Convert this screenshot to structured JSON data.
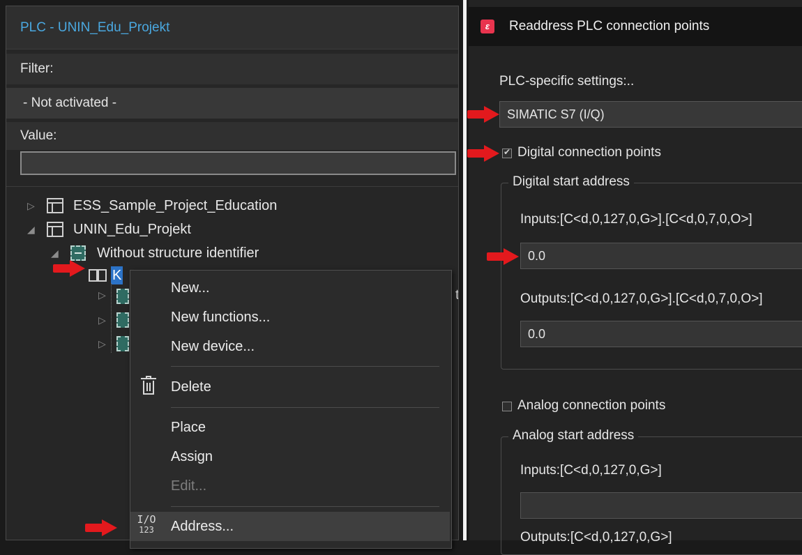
{
  "left_panel": {
    "title": "PLC - UNIN_Edu_Projekt",
    "filter_label": "Filter:",
    "filter_value": "- Not activated -",
    "value_label": "Value:",
    "value_input": "",
    "tree": {
      "items": [
        {
          "label": "ESS_Sample_Project_Education",
          "icon": "project-icon"
        },
        {
          "label": "UNIN_Edu_Projekt",
          "icon": "project-icon"
        },
        {
          "label": "Without structure identifier",
          "icon": "structure-identifier-icon"
        },
        {
          "label": "K",
          "icon": "book-icon",
          "selected": true
        }
      ],
      "stray_char": "t"
    }
  },
  "context_menu": {
    "items": {
      "new": "New...",
      "new_functions": "New functions...",
      "new_device": "New device...",
      "delete": "Delete",
      "place": "Place",
      "assign": "Assign",
      "edit": "Edit...",
      "address": "Address..."
    },
    "io_icon": {
      "top": "I/O",
      "bottom": "123"
    }
  },
  "dialog": {
    "title": "Readdress PLC connection points",
    "plc_settings_label": "PLC-specific settings:..",
    "plc_settings_value": "SIMATIC S7 (I/Q)",
    "digital_checkbox_label": "Digital connection points",
    "digital_checked": true,
    "digital_group_title": "Digital start address",
    "digital_inputs_label": "Inputs:[C<d,0,127,0,G>].[C<d,0,7,0,O>]",
    "digital_inputs_value": "0.0",
    "digital_outputs_label": "Outputs:[C<d,0,127,0,G>].[C<d,0,7,0,O>]",
    "digital_outputs_value": "0.0",
    "analog_checkbox_label": "Analog connection points",
    "analog_checked": false,
    "analog_group_title": "Analog start address",
    "analog_inputs_label": "Inputs:[C<d,0,127,0,G>]",
    "analog_inputs_value": "",
    "analog_outputs_label": "Outputs:[C<d,0,127,0,G>]"
  },
  "colors": {
    "arrow": "#e3191d",
    "selection": "#2c73c7",
    "title_blue": "#4aa8e0",
    "app_icon": "#e8344e"
  }
}
